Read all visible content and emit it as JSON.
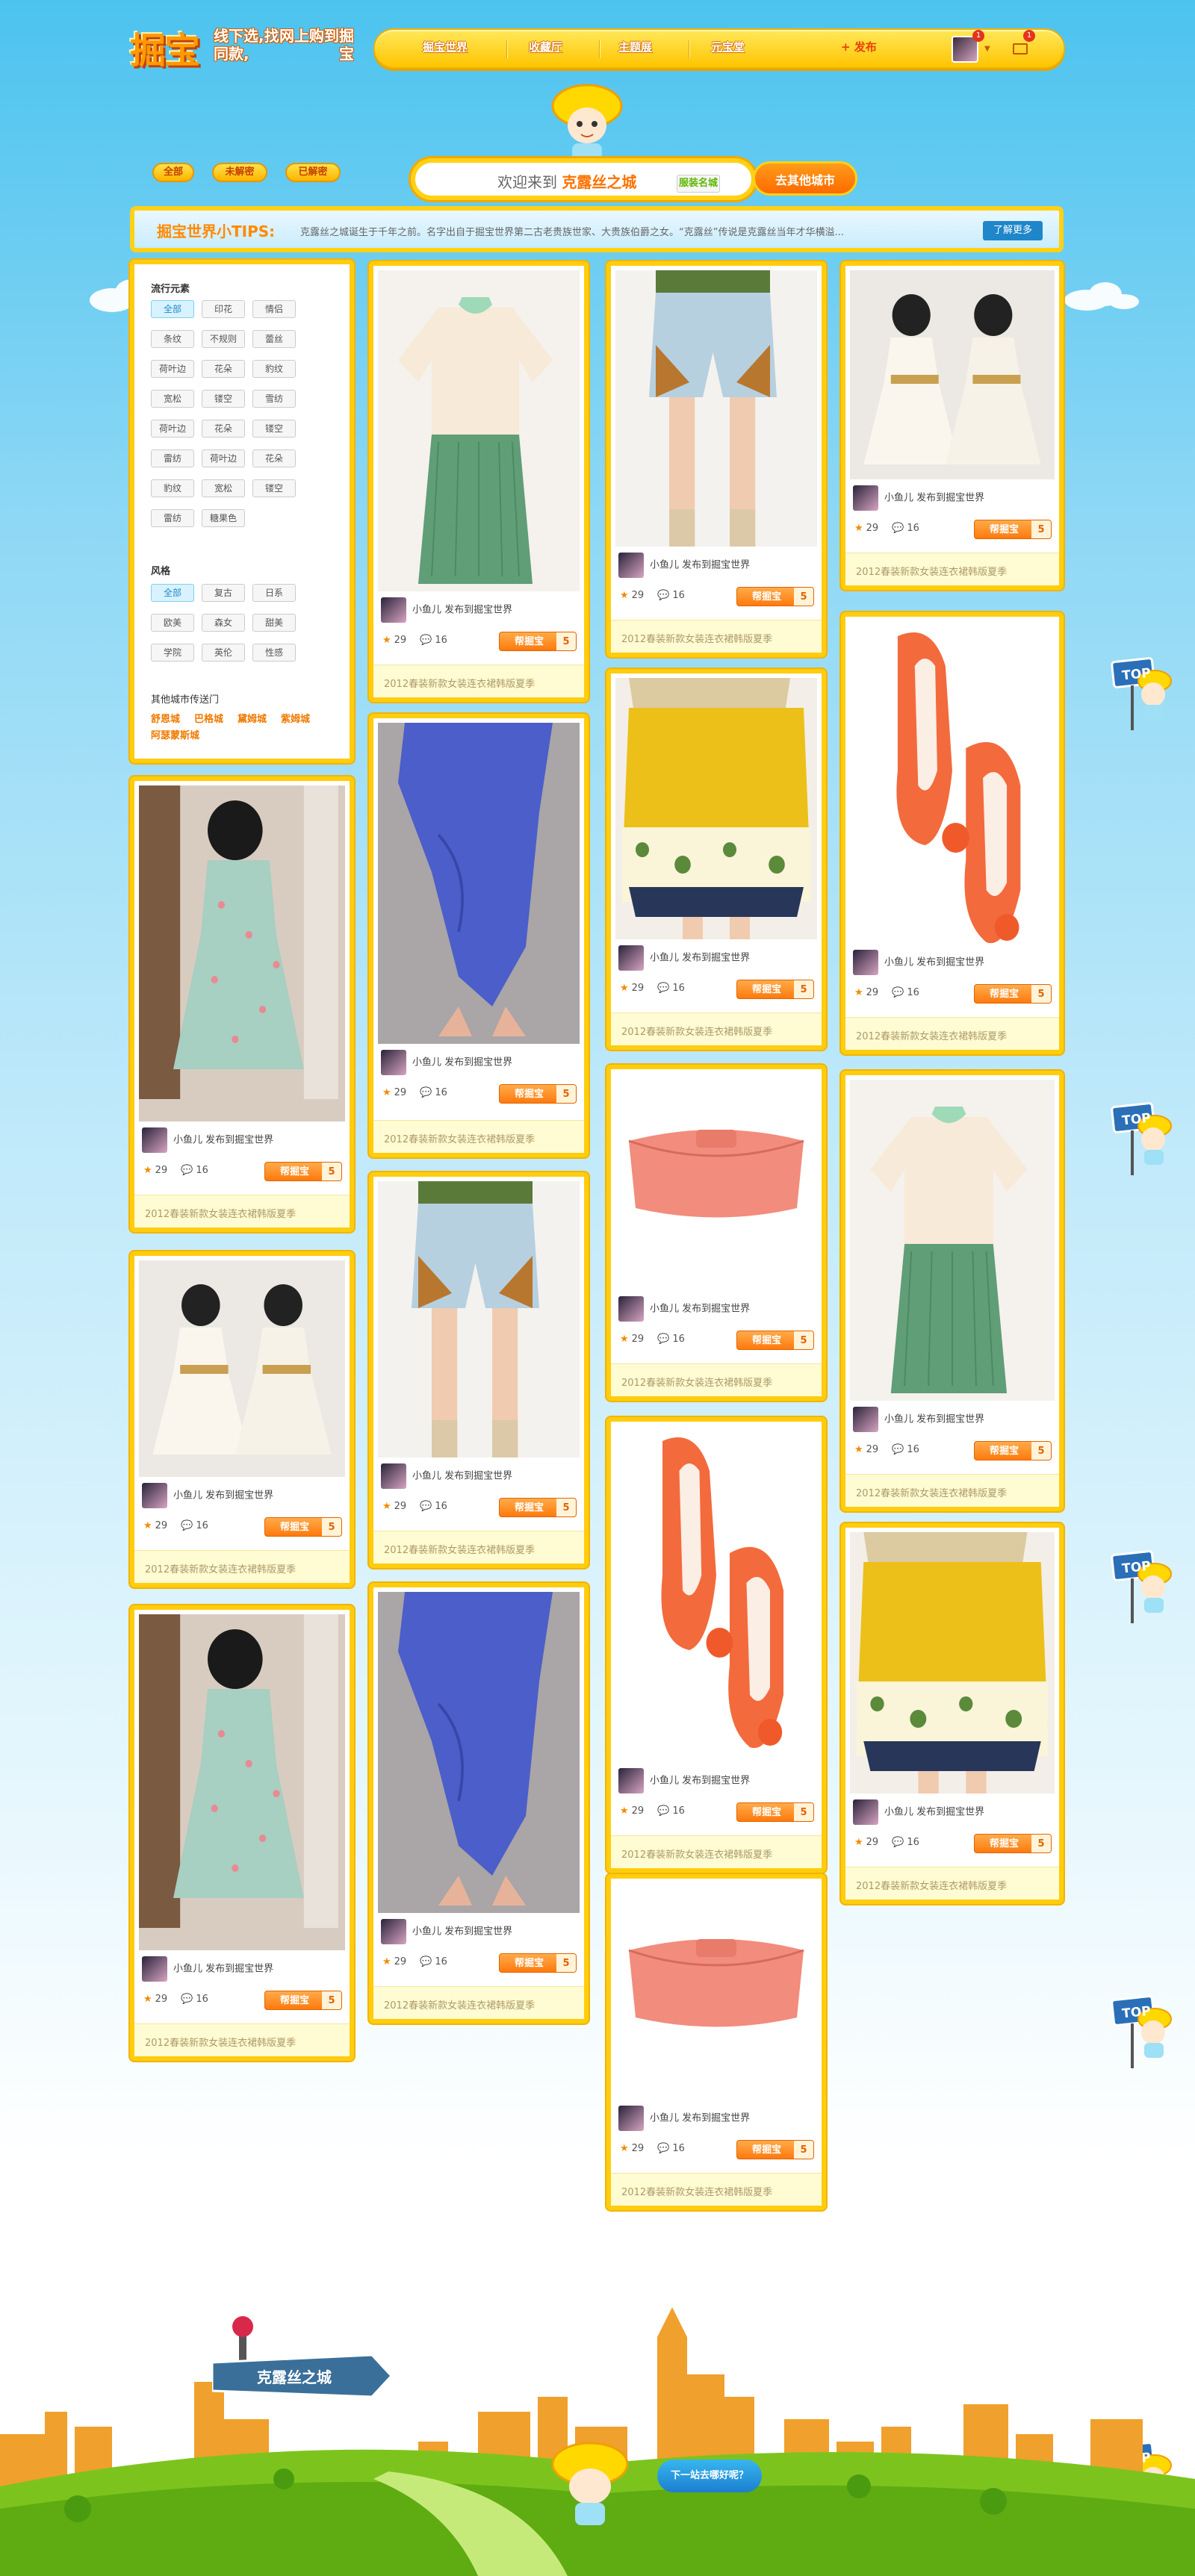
{
  "logo": {
    "main": "掘宝",
    "line1": "线下选,找同款,",
    "line2": "网上购到掘宝"
  },
  "nav": {
    "items": [
      "掘宝世界",
      "收藏厅",
      "主题展",
      "元宝堂"
    ],
    "publish": "+ 发布",
    "badge_user": "1",
    "badge_mail": "1"
  },
  "filterbar": {
    "pills": [
      "全部",
      "未解密",
      "已解密"
    ],
    "welcome_prefix": "欢迎来到",
    "city": "克露丝之城",
    "tag": "服装名城",
    "go_button": "去其他城市"
  },
  "tips": {
    "title": "掘宝世界小TIPS:",
    "text": "克露丝之城诞生于千年之前。名字出自于掘宝世界第二古老贵族世家、大贵族伯爵之女。“克露丝”传说是克露丝当年才华横溢...",
    "more": "了解更多"
  },
  "filters": {
    "section1_title": "流行元素",
    "tags1": [
      "全部",
      "印花",
      "情侣",
      "条纹",
      "不规则",
      "蕾丝",
      "荷叶边",
      "花朵",
      "豹纹",
      "宽松",
      "镂空",
      "雪纺",
      "荷叶边",
      "花朵",
      "镂空",
      "雷纺",
      "荷叶边",
      "花朵",
      "豹纹",
      "宽松",
      "镂空",
      "雷纺",
      "糖果色"
    ],
    "section2_title": "风格",
    "tags2": [
      "全部",
      "复古",
      "日系",
      "欧美",
      "森女",
      "甜美",
      "学院",
      "英伦",
      "性感"
    ],
    "cities_title": "其他城市传送门",
    "cities_row1": [
      "舒恩城",
      "巴格城",
      "黛姆城",
      "紫姆城"
    ],
    "cities_row2": [
      "阿瑟蒙斯城"
    ]
  },
  "card": {
    "user_text": "小鱼儿 发布到掘宝世界",
    "likes": "29",
    "comments": "16",
    "btn_label": "帮掘宝",
    "btn_count": "5",
    "footer": "2012春装新款女装连衣裙韩版夏季"
  },
  "top_label": "TOP",
  "footer": {
    "city_label": "克露丝之城",
    "bubble": "下一站去哪好呢？"
  },
  "colors": {
    "accent": "#ffcd0e",
    "orange": "#ff7a0d",
    "sky": "#4cc3ef",
    "grass": "#7cc41d"
  }
}
